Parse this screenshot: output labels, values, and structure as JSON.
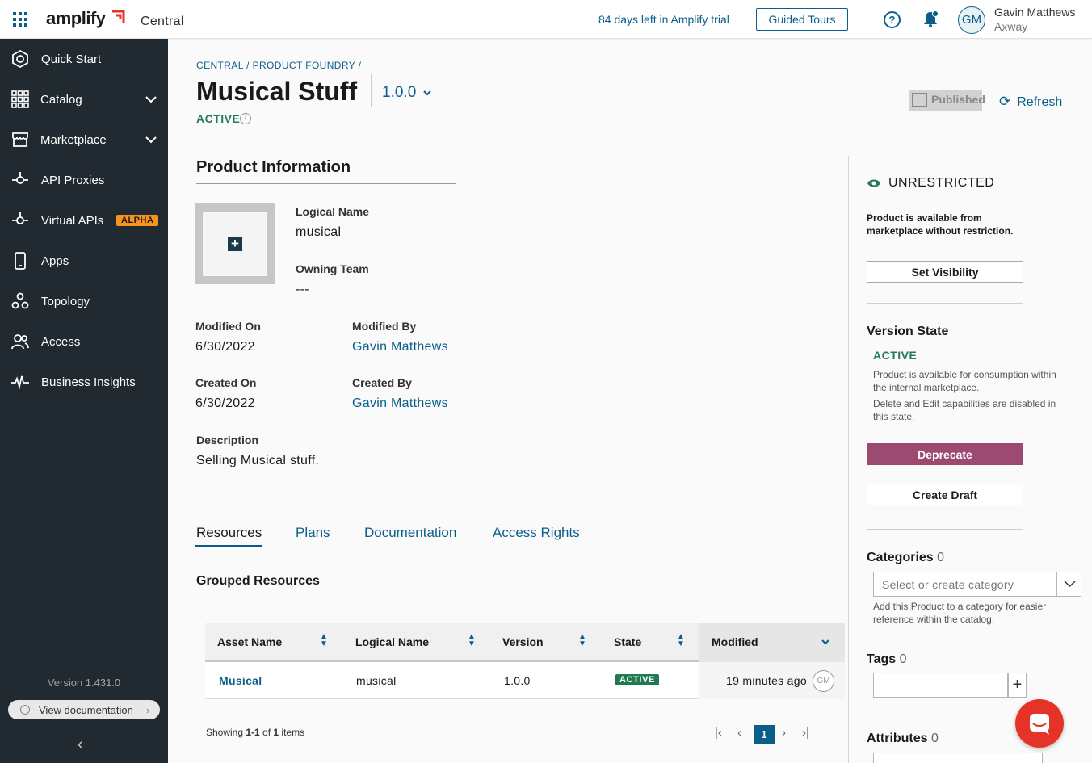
{
  "header": {
    "brand": "amplify",
    "product": "Central",
    "trial_text": "84 days left in Amplify trial",
    "tours_label": "Guided Tours",
    "help_glyph": "?",
    "avatar_initials": "GM",
    "user_name": "Gavin Matthews",
    "user_org": "Axway"
  },
  "sidebar": {
    "items": [
      {
        "label": "Quick Start",
        "icon": "quick-start-icon"
      },
      {
        "label": "Catalog",
        "icon": "catalog-icon",
        "expandable": true
      },
      {
        "label": "Marketplace",
        "icon": "marketplace-icon",
        "expandable": true
      },
      {
        "label": "API Proxies",
        "icon": "api-proxies-icon"
      },
      {
        "label": "Virtual APIs",
        "icon": "virtual-apis-icon",
        "badge": "ALPHA"
      },
      {
        "label": "Apps",
        "icon": "apps-icon"
      },
      {
        "label": "Topology",
        "icon": "topology-icon"
      },
      {
        "label": "Access",
        "icon": "access-icon"
      },
      {
        "label": "Business Insights",
        "icon": "business-insights-icon"
      }
    ],
    "version": "Version 1.431.0",
    "doc_label": "View documentation",
    "collapse_glyph": "‹"
  },
  "page": {
    "breadcrumb": "CENTRAL / PRODUCT FOUNDRY /",
    "title": "Musical Stuff",
    "version": "1.0.0",
    "status": "ACTIVE",
    "info_glyph": "i",
    "published_label": "Published",
    "refresh_label": "Refresh"
  },
  "product_info": {
    "heading": "Product Information",
    "plus_glyph": "+",
    "logical_name_label": "Logical Name",
    "logical_name": "musical",
    "owning_team_label": "Owning Team",
    "owning_team": "---",
    "modified_on_label": "Modified On",
    "modified_on": "6/30/2022",
    "modified_by_label": "Modified By",
    "modified_by": "Gavin Matthews",
    "created_on_label": "Created On",
    "created_on": "6/30/2022",
    "created_by_label": "Created By",
    "created_by": "Gavin Matthews",
    "description_label": "Description",
    "description": "Selling Musical stuff."
  },
  "tabs": [
    {
      "label": "Resources",
      "active": true
    },
    {
      "label": "Plans"
    },
    {
      "label": "Documentation"
    },
    {
      "label": "Access Rights"
    }
  ],
  "resources": {
    "heading": "Grouped Resources",
    "columns": [
      "Asset Name",
      "Logical Name",
      "Version",
      "State",
      "Modified"
    ],
    "rows": [
      {
        "asset_name": "Musical",
        "logical_name": "musical",
        "version": "1.0.0",
        "state": "ACTIVE",
        "modified": "19 minutes ago",
        "modified_by_initials": "GM"
      }
    ],
    "showing_prefix": "Showing ",
    "showing_range": "1-1",
    "showing_of": " of ",
    "showing_total": "1",
    "showing_suffix": " items",
    "current_page": "1"
  },
  "right_panel": {
    "visibility": "UNRESTRICTED",
    "visibility_desc": "Product is available from marketplace without restriction.",
    "set_visibility_label": "Set Visibility",
    "version_state_heading": "Version State",
    "version_state": "ACTIVE",
    "version_desc_1": "Product is available for consumption within the internal marketplace.",
    "version_desc_2": "Delete and Edit capabilities are disabled in this state.",
    "deprecate_label": "Deprecate",
    "create_draft_label": "Create Draft",
    "categories_heading": "Categories",
    "categories_count": "0",
    "category_placeholder": "Select or create category",
    "category_help": "Add this Product to a category for easier reference within the catalog.",
    "tags_heading": "Tags",
    "tags_count": "0",
    "tag_add_glyph": "+",
    "attributes_heading": "Attributes",
    "attributes_count": "0"
  },
  "colors": {
    "brand_blue": "#0a5f8a",
    "active_green": "#267a5b",
    "deprecate": "#9c4a72",
    "sidebar_bg": "#212a30",
    "alpha_badge": "#f7931e",
    "chat": "#e5332a"
  }
}
